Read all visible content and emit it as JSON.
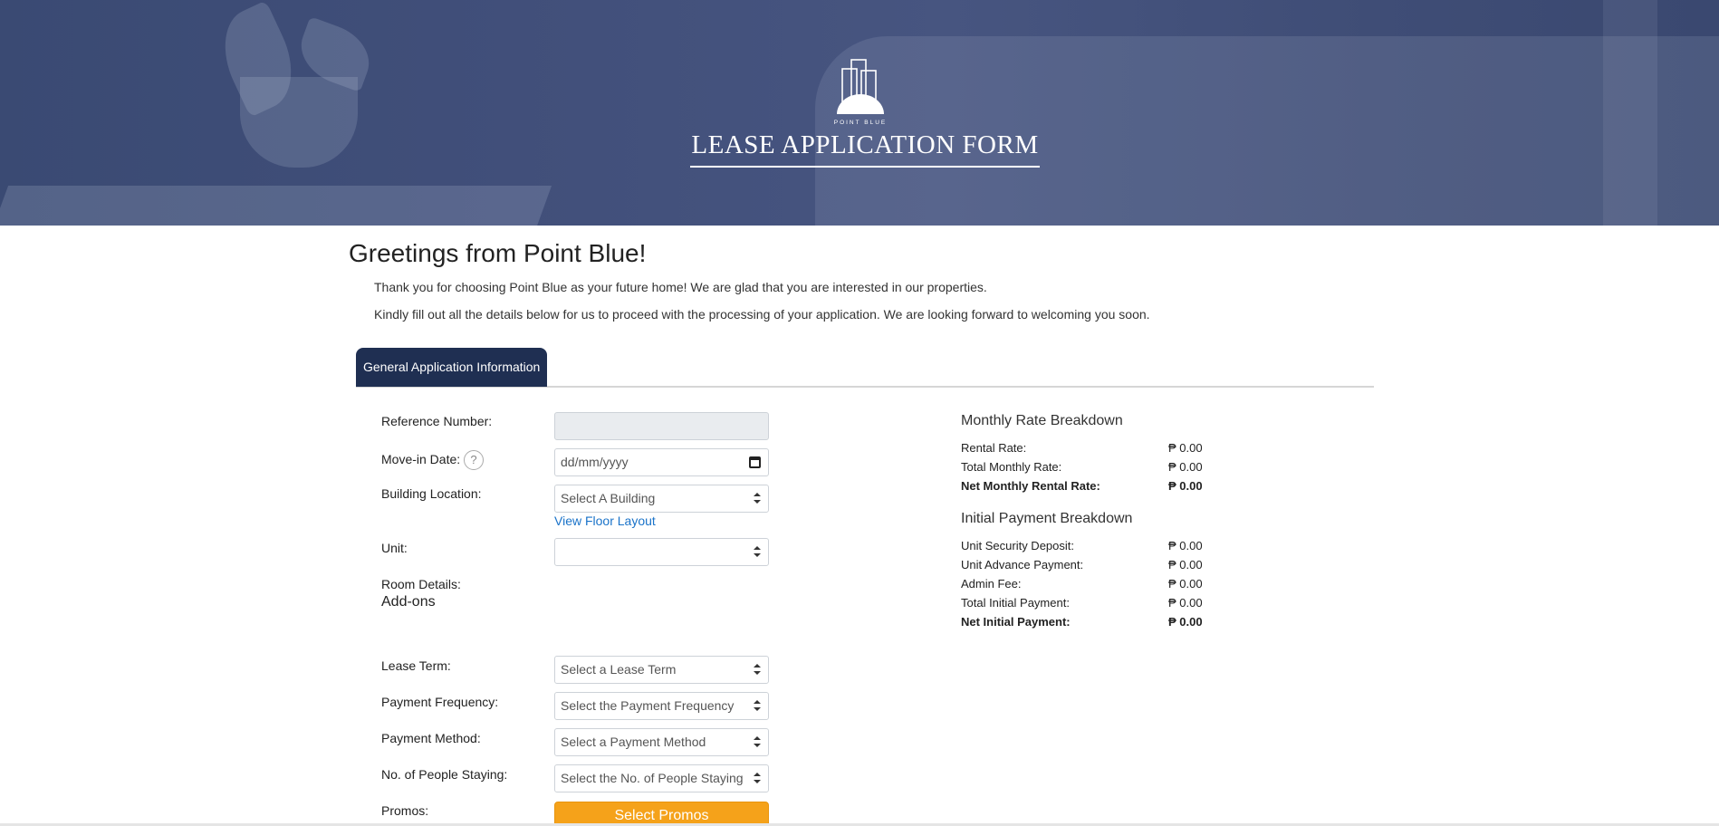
{
  "header": {
    "brand": "POINT BLUE",
    "title": "LEASE APPLICATION FORM"
  },
  "intro": {
    "greeting": "Greetings from Point Blue!",
    "line1": "Thank you for choosing Point Blue as your future home! We are glad that you are interested in our properties.",
    "line2": "Kindly fill out all the details below for us to proceed with the processing of your application. We are looking forward to welcoming you soon."
  },
  "tabs": [
    {
      "label": "General Application Information",
      "active": true
    }
  ],
  "form": {
    "reference_label": "Reference Number:",
    "reference_value": "",
    "movein_label": "Move-in Date:",
    "movein_placeholder": "dd/mm/yyyy",
    "help_icon": "?",
    "building_label": "Building Location:",
    "building_value": "Select A Building",
    "floor_layout_link": "View Floor Layout",
    "unit_label": "Unit:",
    "unit_value": "",
    "room_details_label": "Room Details:",
    "addons_label": "Add-ons",
    "lease_term_label": "Lease Term:",
    "lease_term_value": "Select a Lease Term",
    "payment_freq_label": "Payment Frequency:",
    "payment_freq_value": "Select the Payment Frequency",
    "payment_method_label": "Payment Method:",
    "payment_method_value": "Select a Payment Method",
    "people_label": "No. of People Staying:",
    "people_value": "Select the No. of People Staying",
    "promos_label": "Promos:",
    "promos_button": "Select Promos"
  },
  "monthly": {
    "title": "Monthly Rate Breakdown",
    "rows": [
      {
        "label": "Rental Rate:",
        "value": "₱ 0.00",
        "bold": false
      },
      {
        "label": "Total Monthly Rate:",
        "value": "₱ 0.00",
        "bold": false
      },
      {
        "label": "Net Monthly Rental Rate:",
        "value": "₱ 0.00",
        "bold": true
      }
    ]
  },
  "initial": {
    "title": "Initial Payment Breakdown",
    "rows": [
      {
        "label": "Unit Security Deposit:",
        "value": "₱ 0.00",
        "bold": false
      },
      {
        "label": "Unit Advance Payment:",
        "value": "₱ 0.00",
        "bold": false
      },
      {
        "label": "Admin Fee:",
        "value": "₱ 0.00",
        "bold": false
      },
      {
        "label": "Total Initial Payment:",
        "value": "₱ 0.00",
        "bold": false
      },
      {
        "label": "Net Initial Payment:",
        "value": "₱ 0.00",
        "bold": true
      }
    ]
  },
  "colors": {
    "header_bg": "#414f7a",
    "tab_active": "#1f2f52",
    "link": "#1a73c9",
    "promo_button": "#f5a21a"
  }
}
